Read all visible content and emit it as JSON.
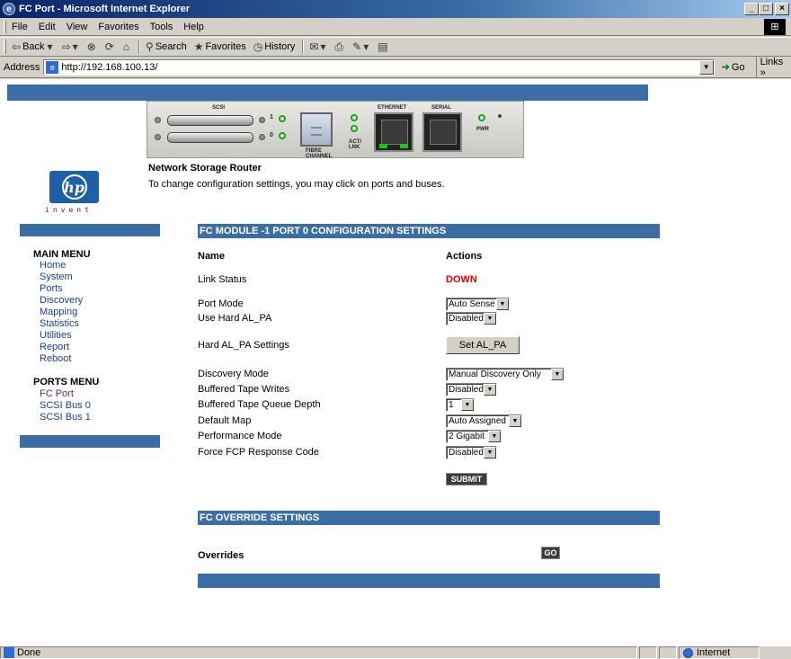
{
  "window": {
    "title": "FC Port - Microsoft Internet Explorer"
  },
  "menubar": [
    "File",
    "Edit",
    "View",
    "Favorites",
    "Tools",
    "Help"
  ],
  "toolbar": {
    "back": "Back",
    "search": "Search",
    "favorites": "Favorites",
    "history": "History"
  },
  "address": {
    "label": "Address",
    "url": "http://192.168.100.13/",
    "go": "Go",
    "links": "Links"
  },
  "device": {
    "labels": {
      "scsi": "SCSI",
      "ethernet": "ETHERNET",
      "serial": "SERIAL",
      "fibre": "FIBRE CHANNEL",
      "actlnk": "ACT/ LNK",
      "pwr": "PWR",
      "one": "1",
      "zero": "0"
    }
  },
  "brand": {
    "logo": "hp",
    "tagline": "invent"
  },
  "header": {
    "title": "Network Storage Router",
    "subtitle": "To change configuration settings, you may click on ports and buses."
  },
  "main_menu": {
    "heading": "MAIN MENU",
    "items": [
      "Home",
      "System",
      "Ports",
      "Discovery",
      "Mapping",
      "Statistics",
      "Utilities",
      "Report",
      "Reboot"
    ]
  },
  "ports_menu": {
    "heading": "PORTS MENU",
    "items": [
      "FC Port",
      "SCSI Bus 0",
      "SCSI Bus 1"
    ]
  },
  "config": {
    "section_title": "FC MODULE -1 PORT 0 CONFIGURATION SETTINGS",
    "col_name": "Name",
    "col_actions": "Actions",
    "link_status_label": "Link Status",
    "link_status_value": "DOWN",
    "port_mode_label": "Port Mode",
    "port_mode_value": "Auto Sense",
    "hard_alpa_label": "Use Hard AL_PA",
    "hard_alpa_value": "Disabled",
    "hard_alpa_settings_label": "Hard AL_PA Settings",
    "set_alpa_button": "Set AL_PA",
    "discovery_mode_label": "Discovery Mode",
    "discovery_mode_value": "Manual Discovery Only",
    "buffered_writes_label": "Buffered Tape Writes",
    "buffered_writes_value": "Disabled",
    "queue_depth_label": "Buffered Tape Queue Depth",
    "queue_depth_value": "1",
    "default_map_label": "Default Map",
    "default_map_value": "Auto Assigned",
    "performance_label": "Performance Mode",
    "performance_value": "2 Gigabit",
    "force_fcp_label": "Force FCP Response Code",
    "force_fcp_value": "Disabled",
    "submit_button": "SUBMIT"
  },
  "override": {
    "section_title": "FC OVERRIDE SETTINGS",
    "label": "Overrides",
    "go_button": "GO"
  },
  "status": {
    "text": "Done",
    "zone": "Internet"
  }
}
